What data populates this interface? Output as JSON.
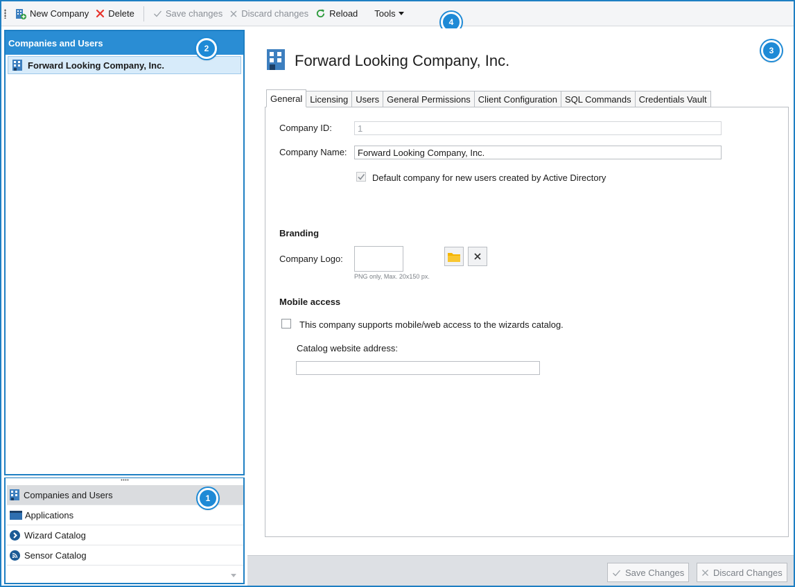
{
  "toolbar": {
    "new_company_label": "New Company",
    "delete_label": "Delete",
    "save_changes_label": "Save changes",
    "discard_changes_label": "Discard changes",
    "reload_label": "Reload",
    "tools_label": "Tools"
  },
  "badges": {
    "nav": "1",
    "tree": "2",
    "detail": "3",
    "toolbar": "4"
  },
  "tree": {
    "header": "Companies and Users",
    "items": [
      {
        "label": "Forward Looking Company, Inc."
      }
    ]
  },
  "nav": {
    "items": [
      {
        "label": "Companies and Users",
        "icon": "building-icon"
      },
      {
        "label": "Applications",
        "icon": "window-icon"
      },
      {
        "label": "Wizard Catalog",
        "icon": "chevron-circle-icon"
      },
      {
        "label": "Sensor Catalog",
        "icon": "rss-icon"
      }
    ]
  },
  "detail": {
    "title": "Forward Looking Company, Inc.",
    "tabs": [
      {
        "label": "General",
        "active": true
      },
      {
        "label": "Licensing"
      },
      {
        "label": "Users"
      },
      {
        "label": "General Permissions"
      },
      {
        "label": "Client Configuration"
      },
      {
        "label": "SQL Commands"
      },
      {
        "label": "Credentials Vault"
      }
    ],
    "general": {
      "company_id_label": "Company ID:",
      "company_id_value": "1",
      "company_name_label": "Company Name:",
      "company_name_value": "Forward Looking Company, Inc.",
      "default_company_label": "Default company for new users created by Active Directory",
      "default_company_checked": true,
      "branding_heading": "Branding",
      "company_logo_label": "Company Logo:",
      "logo_hint": "PNG only, Max. 20x150 px.",
      "mobile_heading": "Mobile access",
      "mobile_support_label": "This company supports mobile/web access to the wizards catalog.",
      "mobile_support_checked": false,
      "catalog_address_label": "Catalog website address:",
      "catalog_address_value": ""
    }
  },
  "footer": {
    "save_label": "Save Changes",
    "discard_label": "Discard Changes"
  },
  "colors": {
    "accent": "#1e7fc3",
    "header_blue": "#2a8dd4",
    "selection": "#d7ebfa",
    "delete_red": "#e8332b",
    "reload_green": "#2e9b3e",
    "folder_yellow": "#f5b400"
  }
}
